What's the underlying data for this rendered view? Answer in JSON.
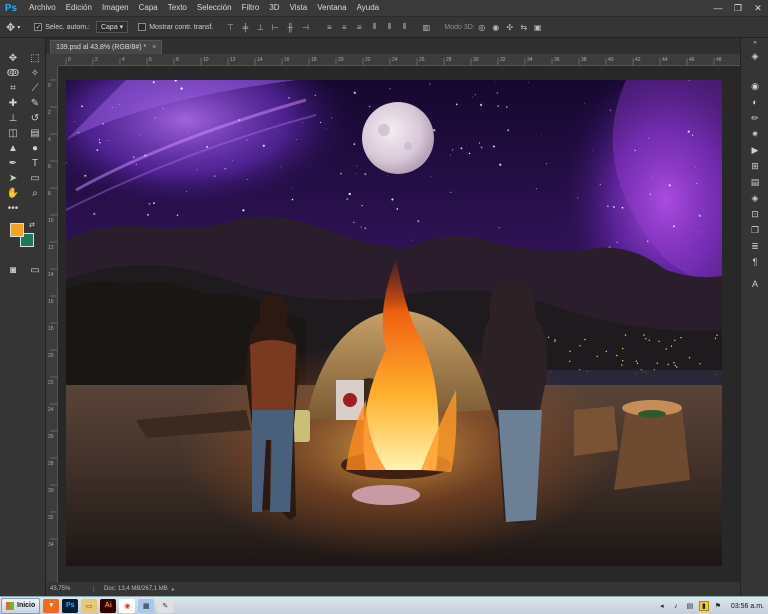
{
  "app": {
    "logo": "Ps"
  },
  "menubar": {
    "items": [
      "Archivo",
      "Edición",
      "Imagen",
      "Capa",
      "Texto",
      "Selección",
      "Filtro",
      "3D",
      "Vista",
      "Ventana",
      "Ayuda"
    ],
    "window_controls": [
      "minimize-icon",
      "maximize-icon",
      "close-icon"
    ]
  },
  "options": {
    "auto_select_label": "Selec. autom.:",
    "auto_select_checked": true,
    "auto_select_target": "Capa",
    "show_transform_label": "Mostrar contr. transf.",
    "mode3d_label": "Modo 3D:"
  },
  "document": {
    "tab_title": "139.psd al 43,8% (RGB/8#) *",
    "close_symbol": "×"
  },
  "colors": {
    "foreground": "#f7a21b",
    "background": "#1a7b5c",
    "accent": "#31a8ff"
  },
  "status": {
    "zoom": "43,75%",
    "doc_size": "Doc: 13,4 MB/267,1 MB"
  },
  "taskbar": {
    "start_label": "Inicio",
    "apps": [
      "brave-icon",
      "photoshop-icon",
      "folder-icon",
      "illustrator-icon",
      "chrome-icon",
      "explorer-icon",
      "paint-icon"
    ],
    "clock": "03:56 a.m.",
    "tray": [
      "speaker-icon",
      "network-icon",
      "battery-icon",
      "flag-icon"
    ]
  },
  "rulers": {
    "top_labels": [
      "0",
      "2",
      "4",
      "6",
      "8",
      "10",
      "12",
      "14",
      "16",
      "18",
      "20",
      "22",
      "24",
      "26",
      "28",
      "30",
      "32",
      "34",
      "36",
      "38",
      "40",
      "42",
      "44",
      "46",
      "48"
    ],
    "left_labels": [
      "0",
      "2",
      "4",
      "6",
      "8",
      "10",
      "12",
      "14",
      "16",
      "18",
      "20",
      "22",
      "24",
      "26",
      "28",
      "30",
      "32",
      "34"
    ]
  }
}
